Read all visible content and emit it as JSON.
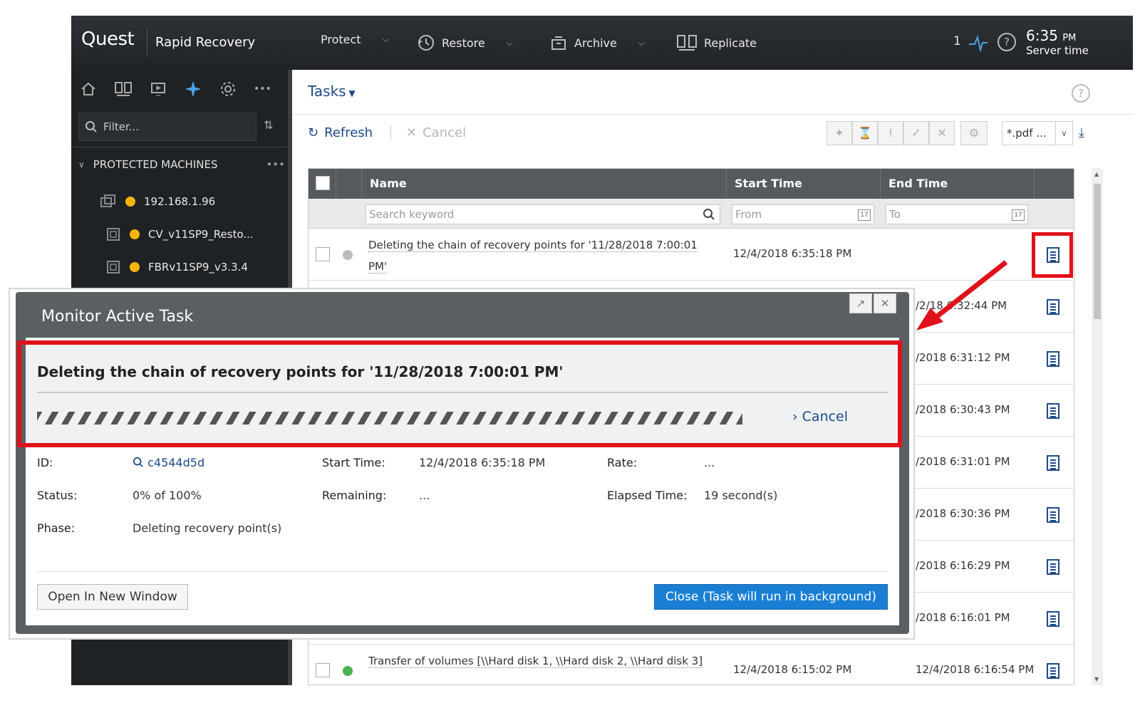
{
  "header": {
    "logo": "Quest",
    "product": "Rapid Recovery",
    "nav": [
      {
        "label": "Protect",
        "icon": "shield-icon"
      },
      {
        "label": "Restore",
        "icon": "history-icon"
      },
      {
        "label": "Archive",
        "icon": "archive-icon"
      },
      {
        "label": "Replicate",
        "icon": "replicate-icon"
      }
    ],
    "event_count": "1",
    "server_time": "6:35",
    "server_time_ampm": "PM",
    "server_time_label": "Server time"
  },
  "sidebar": {
    "filter_placeholder": "Filter...",
    "section_title": "PROTECTED MACHINES",
    "section_more": "•••",
    "machines": [
      {
        "name": "192.168.1.96"
      },
      {
        "name": "CV_v11SP9_Resto..."
      },
      {
        "name": "FBRv11SP9_v3.3.4"
      }
    ]
  },
  "tasks": {
    "title": "Tasks",
    "refresh_label": "Refresh",
    "cancel_label": "Cancel",
    "export_format": "*.pdf ...",
    "columns": {
      "name": "Name",
      "start": "Start Time",
      "end": "End Time"
    },
    "filters": {
      "keyword": "Search keyword",
      "from": "From",
      "to": "To"
    },
    "rows": [
      {
        "name": "Deleting the chain of recovery points for '11/28/2018 7:00:01 PM'",
        "start": "12/4/2018 6:35:18 PM",
        "end": ""
      },
      {
        "name": "",
        "start": "",
        "end": "/2/18 6:32:44 PM"
      },
      {
        "name": "",
        "start": "",
        "end": "/2018 6:31:12 PM"
      },
      {
        "name": "",
        "start": "",
        "end": "/2018 6:30:43 PM"
      },
      {
        "name": "",
        "start": "",
        "end": "/2018 6:31:01 PM"
      },
      {
        "name": "",
        "start": "",
        "end": "/2018 6:30:36 PM"
      },
      {
        "name": "",
        "start": "",
        "end": "/2018 6:16:29 PM"
      },
      {
        "name": "",
        "start": "",
        "end": "/2018 6:16:01 PM"
      },
      {
        "name": "Transfer of volumes [\\\\Hard disk 1, \\\\Hard disk 2, \\\\Hard disk 3]",
        "start": "12/4/2018 6:15:02 PM",
        "end": "12/4/2018 6:16:54 PM"
      }
    ]
  },
  "modal": {
    "title": "Monitor Active Task",
    "task_name": "Deleting the chain of recovery points for '11/28/2018 7:00:01 PM'",
    "cancel_link": "Cancel",
    "progress_percent": 0,
    "details": {
      "id_label": "ID:",
      "id_value": "c4544d5d",
      "status_label": "Status:",
      "status_value": "0% of 100%",
      "phase_label": "Phase:",
      "phase_value": "Deleting recovery point(s)",
      "start_label": "Start Time:",
      "start_value": "12/4/2018 6:35:18 PM",
      "remaining_label": "Remaining:",
      "remaining_value": "...",
      "rate_label": "Rate:",
      "rate_value": "...",
      "elapsed_label": "Elapsed Time:",
      "elapsed_value": "19 second(s)"
    },
    "open_new_window": "Open In New Window",
    "close_background": "Close (Task will run in background)"
  },
  "colors": {
    "accent": "#1a7fd4",
    "link": "#1b4a8a",
    "annotation": "#e0111b",
    "status_running": "#bdbdbd",
    "machine_warning": "#f2b600"
  }
}
